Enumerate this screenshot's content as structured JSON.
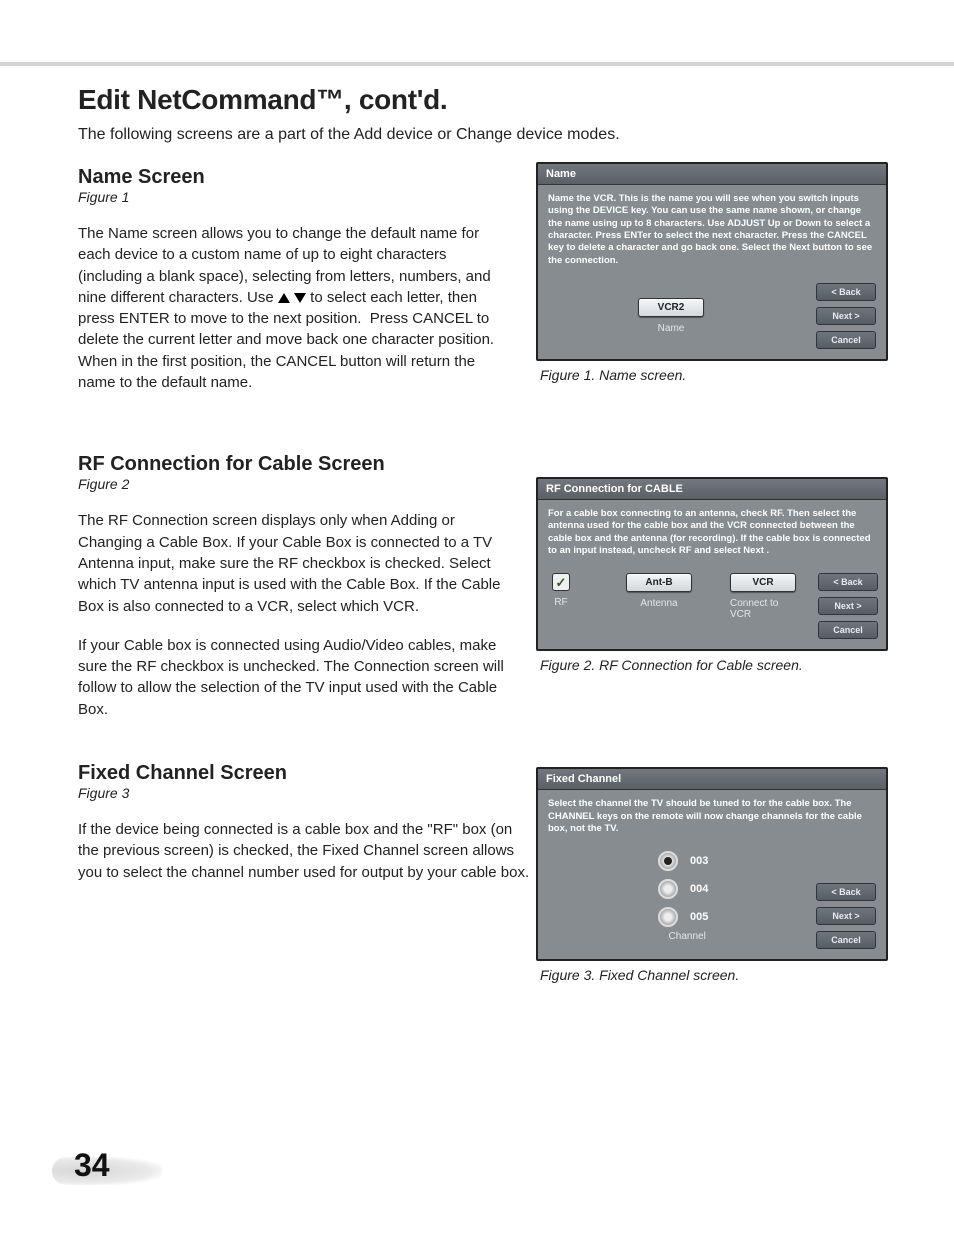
{
  "page_title": "Edit NetCommand™, cont'd.",
  "intro": "The following screens are a part of the Add device or Change device modes.",
  "page_number": "34",
  "sections": {
    "name": {
      "heading": "Name Screen",
      "fig_ref": "Figure 1",
      "body": "The Name screen allows you to change the default name for each device to a custom name of up to eight characters (including a blank space), selecting from letters, numbers, and nine different characters. Use ▲ ▼ to select each letter, then press ENTER to move to the next position.  Press CANCEL to delete the current letter and move back one character position.  When in the first position, the CANCEL button will return the name to the default name."
    },
    "rf": {
      "heading": "RF Connection for Cable Screen",
      "fig_ref": "Figure 2",
      "body1": "The RF Connection screen displays only when Adding or Changing a Cable Box.  If your Cable Box is connected to a TV Antenna input, make sure the RF checkbox is checked.  Select which TV antenna input is used with the Cable Box.  If the Cable Box is also connected to a VCR, select which VCR.",
      "body2": "If your Cable box is connected using Audio/Video cables, make sure the RF checkbox is unchecked. The Connection screen will follow to allow the selection of the TV input used with the Cable Box."
    },
    "fixed": {
      "heading": "Fixed Channel Screen",
      "fig_ref": "Figure 3",
      "body": "If the device being connected is a cable box and the \"RF\" box (on the previous screen) is checked, the Fixed Channel screen allows you to select the channel number used for output by your cable box."
    }
  },
  "figures": {
    "f1": {
      "title": "Name",
      "desc": "Name the VCR.  This is the name you will see when you switch inputs using the DEVICE key.  You can use the same name shown, or change the name using up to 8 characters. Use ADJUST Up or Down to select a character.  Press ENTer to select the next character.  Press the CANCEL key to delete a character and go back one.  Select the Next button to see the connection.",
      "value": "VCR2",
      "value_label": "Name",
      "buttons": {
        "back": "< Back",
        "next": "Next >",
        "cancel": "Cancel"
      },
      "caption": "Figure 1.  Name screen."
    },
    "f2": {
      "title": "RF Connection for CABLE",
      "desc": "For a cable box connecting to an antenna, check RF.  Then select the antenna used for the cable box and the VCR connected between the cable box and the antenna (for recording).  If the cable box is connected to an input instead, uncheck RF and select Next .",
      "rf_label": "RF",
      "antenna_value": "Ant-B",
      "antenna_label": "Antenna",
      "vcr_value": "VCR",
      "vcr_label": "Connect to VCR",
      "buttons": {
        "back": "< Back",
        "next": "Next >",
        "cancel": "Cancel"
      },
      "caption": "Figure 2.  RF Connection for Cable screen."
    },
    "f3": {
      "title": "Fixed Channel",
      "desc": "Select the channel the TV should be tuned to for the cable box.  The CHANNEL keys on the remote will now change channels for the cable box, not the TV.",
      "options": [
        "003",
        "004",
        "005"
      ],
      "selected": 0,
      "group_label": "Channel",
      "buttons": {
        "back": "< Back",
        "next": "Next >",
        "cancel": "Cancel"
      },
      "caption": "Figure 3.  Fixed Channel screen."
    }
  }
}
